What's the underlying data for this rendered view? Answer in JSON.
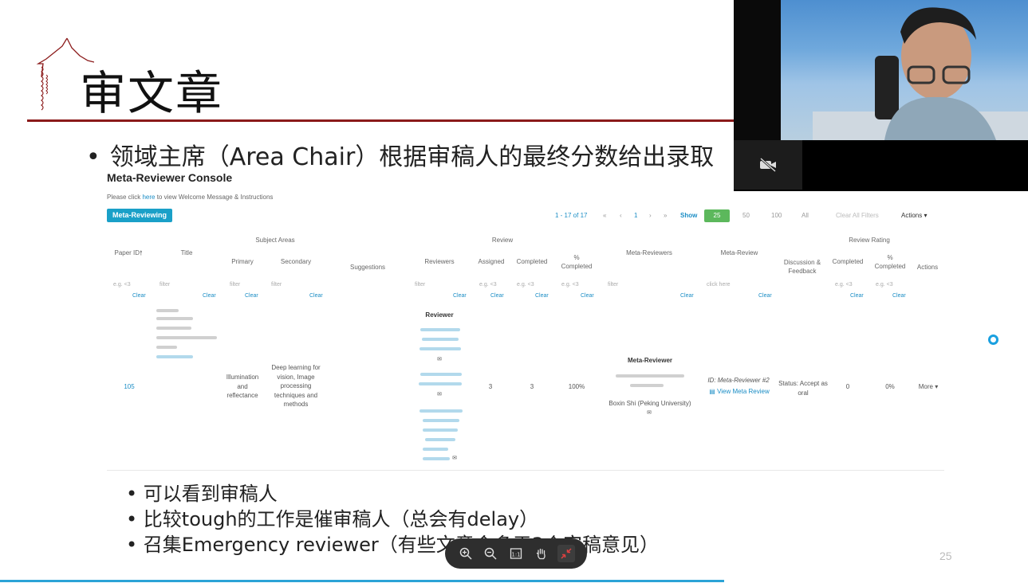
{
  "slide": {
    "title": "审文章",
    "bullet_main": "领域主席（Area Chair）根据审稿人的最终分数给出录取",
    "bullets": [
      "可以看到审稿人",
      "比较tough的工作是催审稿人（总会有delay）",
      "召集Emergency reviewer（有些文章会多于3个审稿意见）"
    ],
    "page_number": "25"
  },
  "console": {
    "title": "Meta-Reviewer Console",
    "instruction_pre": "Please click ",
    "instruction_link": "here",
    "instruction_post": " to view Welcome Message & Instructions",
    "role_button": "Meta-Reviewing",
    "pager": {
      "count": "1 - 17 of 17",
      "first": "«",
      "prev": "‹",
      "page": "1",
      "next": "›",
      "last": "»",
      "show_label": "Show",
      "show_selected": "25",
      "show_50": "50",
      "show_100": "100",
      "show_all": "All",
      "clear_filters": "Clear All Filters",
      "actions": "Actions"
    },
    "headers": {
      "subject_areas": "Subject Areas",
      "review": "Review",
      "review_rating": "Review Rating",
      "paper_id": "Paper ID",
      "title": "Title",
      "primary": "Primary",
      "secondary": "Secondary",
      "suggestions": "Suggestions",
      "reviewers": "Reviewers",
      "assigned": "Assigned",
      "completed": "Completed",
      "pct_completed": "% Completed",
      "meta_reviewers": "Meta-Reviewers",
      "meta_review": "Meta-Review",
      "discussion": "Discussion & Feedback",
      "rating_completed": "Completed",
      "rating_pct": "% Completed",
      "actions": "Actions"
    },
    "filters": {
      "paper_id": "e.g. <3",
      "title": "filter",
      "primary": "filter",
      "secondary": "filter",
      "reviewers": "filter",
      "assigned": "e.g. <3",
      "completed": "e.g. <3",
      "pct": "e.g. <3",
      "meta_reviewers": "filter",
      "meta_review": "click here",
      "rating_completed": "e.g. <3",
      "rating_pct": "e.g. <3",
      "clear": "Clear"
    },
    "row": {
      "paper_id": "105",
      "primary": "Illumination and reflectance",
      "secondary": "Deep learning for vision, Image processing techniques and methods",
      "reviewer_heading": "Reviewer",
      "assigned": "3",
      "completed": "3",
      "pct_completed": "100%",
      "meta_reviewer_heading": "Meta-Reviewer",
      "meta_reviewer_name": "Boxin Shi (Peking University)",
      "meta_review_id": "ID: Meta-Reviewer #2",
      "view_meta_review": "View Meta Review",
      "discussion": "Status: Accept as oral",
      "rating_completed": "0",
      "rating_pct": "0%",
      "more": "More"
    }
  },
  "colors": {
    "accent_red": "#8b1a1a",
    "link_blue": "#1a8dc5",
    "button_teal": "#1aa0c8",
    "show_green": "#5cb85c",
    "rule_blue": "#2ba3d6"
  }
}
